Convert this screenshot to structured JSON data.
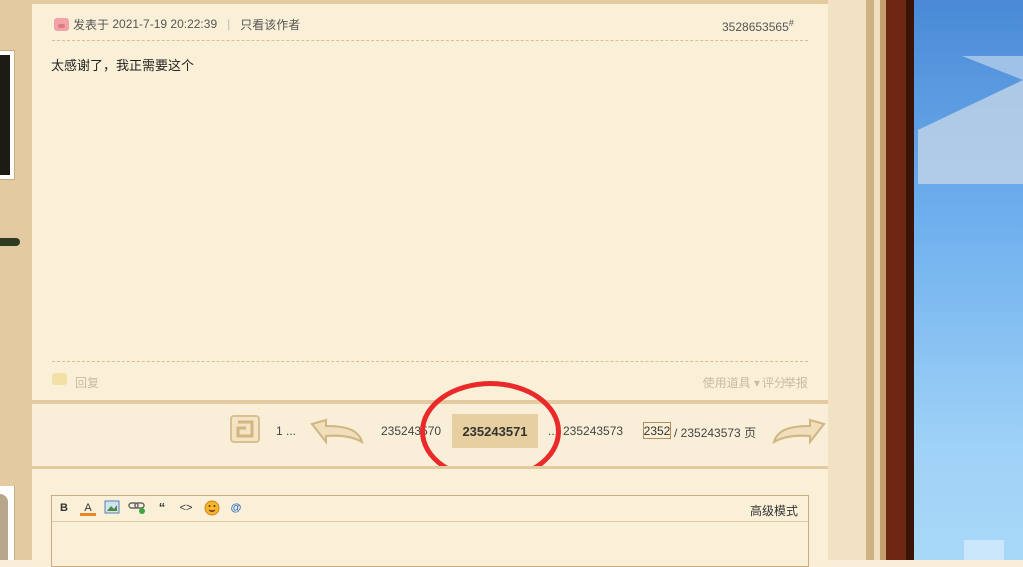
{
  "post": {
    "posted_label": "发表于",
    "date": "2021-7-19 20:22:39",
    "only_author": "只看该作者",
    "floor_number": "3528653565",
    "floor_mark": "#",
    "content": "太感谢了，我正需要这个",
    "reply": "回复",
    "use_tools": "使用道具 ▾",
    "rate": "评分",
    "report": "举报"
  },
  "pagination": {
    "first": "1 ...",
    "prev_page": "235243570",
    "current_page": "235243571",
    "ellipsis": "...",
    "last_page": "235243573",
    "page_input_value": "2352",
    "total_text": "/ 235243573 页"
  },
  "editor": {
    "bold": "B",
    "font_color": "A",
    "quote": "“",
    "code": "<>",
    "at": "@",
    "advanced_mode": "高级模式"
  },
  "colors": {
    "background": "#faf0d8",
    "frame": "#e4caa1",
    "current_page_bg": "#e8cf9f",
    "annotation_circle": "#ea2a2a"
  }
}
